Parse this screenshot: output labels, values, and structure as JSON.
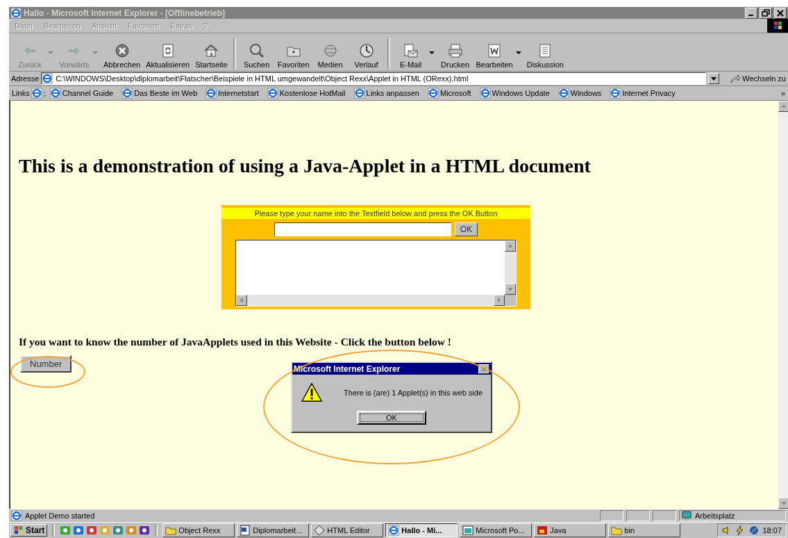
{
  "window": {
    "title": "Hallo - Microsoft Internet Explorer - [Offlinebetrieb]"
  },
  "menu": [
    "Datei",
    "Bearbeiten",
    "Ansicht",
    "Favoriten",
    "Extras",
    "?"
  ],
  "toolbar": [
    {
      "kind": "back",
      "label": "Zurück",
      "disabled": true,
      "dropdown": true
    },
    {
      "kind": "forward",
      "label": "Vorwärts",
      "disabled": true,
      "dropdown": true
    },
    {
      "kind": "stop",
      "label": "Abbrechen",
      "disabled": false,
      "dropdown": false
    },
    {
      "kind": "refresh",
      "label": "Aktualisieren",
      "disabled": false,
      "dropdown": false
    },
    {
      "kind": "home",
      "label": "Startseite",
      "disabled": false,
      "dropdown": false
    },
    {
      "kind": "search",
      "label": "Suchen",
      "disabled": false,
      "dropdown": false
    },
    {
      "kind": "favorites",
      "label": "Favoriten",
      "disabled": false,
      "dropdown": false
    },
    {
      "kind": "media",
      "label": "Medien",
      "disabled": false,
      "dropdown": false
    },
    {
      "kind": "history",
      "label": "Verlauf",
      "disabled": false,
      "dropdown": false
    },
    {
      "kind": "mail",
      "label": "E-Mail",
      "disabled": false,
      "dropdown": true
    },
    {
      "kind": "print",
      "label": "Drucken",
      "disabled": false,
      "dropdown": false
    },
    {
      "kind": "edit",
      "label": "Bearbeiten",
      "disabled": false,
      "dropdown": true
    },
    {
      "kind": "discuss",
      "label": "Diskussion",
      "disabled": false,
      "dropdown": false
    }
  ],
  "address": {
    "label": "Adresse",
    "value": "C:\\WINDOWS\\Desktop\\diplomarbeit\\Flatscher\\Beispiele in HTML umgewandelt\\Object Rexx\\Applet in HTML (ORexx).html",
    "go": "Wechseln zu"
  },
  "links": {
    "label": "Links",
    "separator": ";",
    "items": [
      "Channel Guide",
      "Das Beste im Web",
      "Internetstart",
      "Kostenlose HotMail",
      "Links anpassen",
      "Microsoft",
      "Windows Update",
      "Windows",
      "Internet Privacy"
    ],
    "more": "»"
  },
  "page": {
    "heading": "This is a demonstration of using a Java-Applet in a HTML document",
    "applet": {
      "prompt": "Please type your name into the Textfield below and press the OK Button",
      "ok": "OK"
    },
    "question": "If you want to know the number of JavaApplets used in this Website - Click the button below !",
    "number_button": "Number"
  },
  "dialog": {
    "title": "Microsoft Internet Explorer",
    "message": "There is (are) 1 Applet(s) in this web side",
    "ok": "OK"
  },
  "status_bar": {
    "text": "Applet Demo started",
    "zone": "Arbeitsplatz"
  },
  "taskbar": {
    "start": "Start",
    "quick_launch": [
      {
        "kind": "notepad"
      },
      {
        "kind": "ie"
      },
      {
        "kind": "outlook"
      },
      {
        "kind": "explorer"
      },
      {
        "kind": "network"
      },
      {
        "kind": "link"
      },
      {
        "kind": "media"
      }
    ],
    "tasks": [
      {
        "kind": "folder",
        "label": "Object Rexx",
        "selected": false
      },
      {
        "kind": "word",
        "label": "Diplomarbeit...",
        "selected": false
      },
      {
        "kind": "editor",
        "label": "HTML Editor",
        "selected": false
      },
      {
        "kind": "ie",
        "label": "Hallo - Mi...",
        "selected": true
      },
      {
        "kind": "ppt",
        "label": "Microsoft Po...",
        "selected": false
      },
      {
        "kind": "java",
        "label": "Java",
        "selected": false
      },
      {
        "kind": "folder",
        "label": "bin",
        "selected": false
      }
    ],
    "clock": "18:07"
  }
}
